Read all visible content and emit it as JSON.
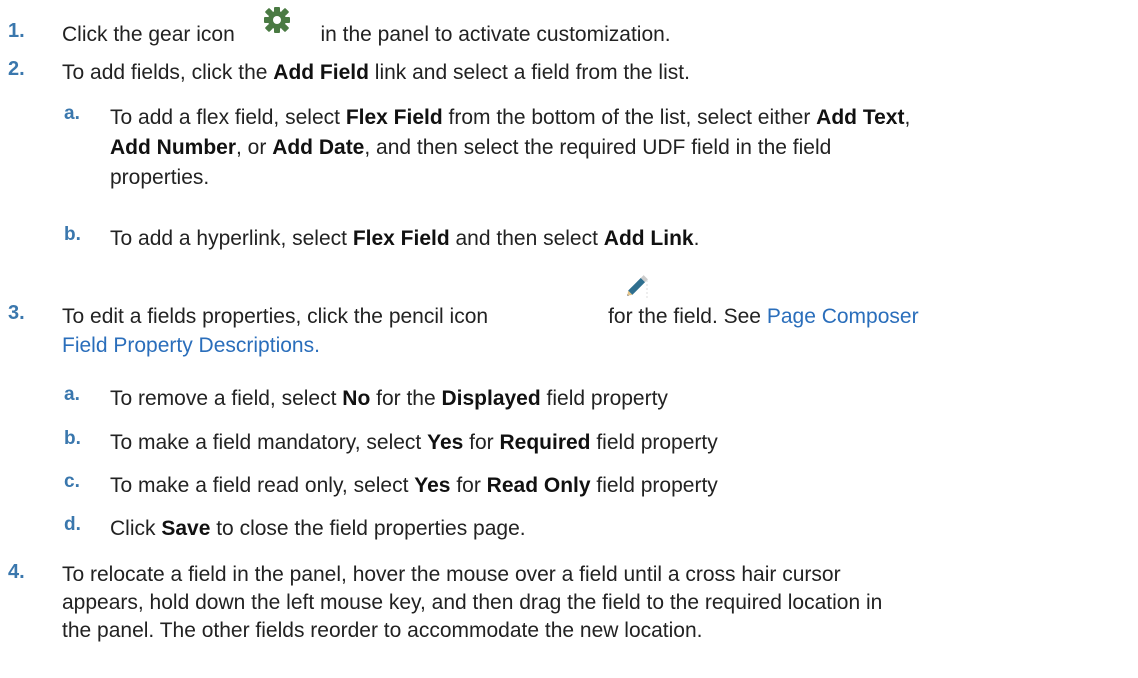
{
  "steps": [
    {
      "num": "1.",
      "a": "Click the gear icon",
      "b": "in the panel to activate customization."
    },
    {
      "num": "2.",
      "a": "To add fields, click the ",
      "b1": "Add Field",
      "c": " link and select a field from the list.",
      "subs": [
        {
          "num": "a.",
          "t1": "To add a flex field, select ",
          "b1": "Flex Field",
          "t2": " from the bottom of the list, select either ",
          "b2": "Add Text",
          "t3": ",",
          "b3": "Add Number",
          "t4": ", or ",
          "b4": "Add Date",
          "t5": ", and then select the required UDF field in the field",
          "t6": "properties."
        },
        {
          "num": "b.",
          "t1": "To add a hyperlink, select ",
          "b1": "Flex Field",
          "t2": " and then select ",
          "b2": "Add Link",
          "t3": "."
        }
      ]
    },
    {
      "num": "3.",
      "a": "To edit a fields properties, click the pencil icon",
      "b": "for the field. See ",
      "link1": "Page Composer",
      "link2": "Field Property Descriptions.",
      "subs": [
        {
          "num": "a.",
          "t1": "To remove a field, select ",
          "b1": "No",
          "t2": " for the ",
          "b2": "Displayed",
          "t3": " field property"
        },
        {
          "num": "b.",
          "t1": "To make a field mandatory, select ",
          "b1": "Yes",
          "t2": " for ",
          "b2": "Required",
          "t3": " field property"
        },
        {
          "num": "c.",
          "t1": "To make a field read only, select ",
          "b1": "Yes",
          "t2": " for ",
          "b2": "Read Only",
          "t3": " field property"
        },
        {
          "num": "d.",
          "t1": "Click ",
          "b1": "Save",
          "t2": " to close the field properties page."
        }
      ]
    },
    {
      "num": "4.",
      "line1": "To relocate a field in the panel, hover the mouse over a field until a cross hair cursor",
      "line2": "appears, hold down the left mouse key, and then drag the field to the required location in",
      "line3": "the panel. The other fields reorder to accommodate the new location."
    }
  ],
  "icons": {
    "gear": "gear-icon",
    "pencil": "pencil-icon"
  },
  "colors": {
    "number": "#3a77ad",
    "link": "#2a6ebb"
  }
}
